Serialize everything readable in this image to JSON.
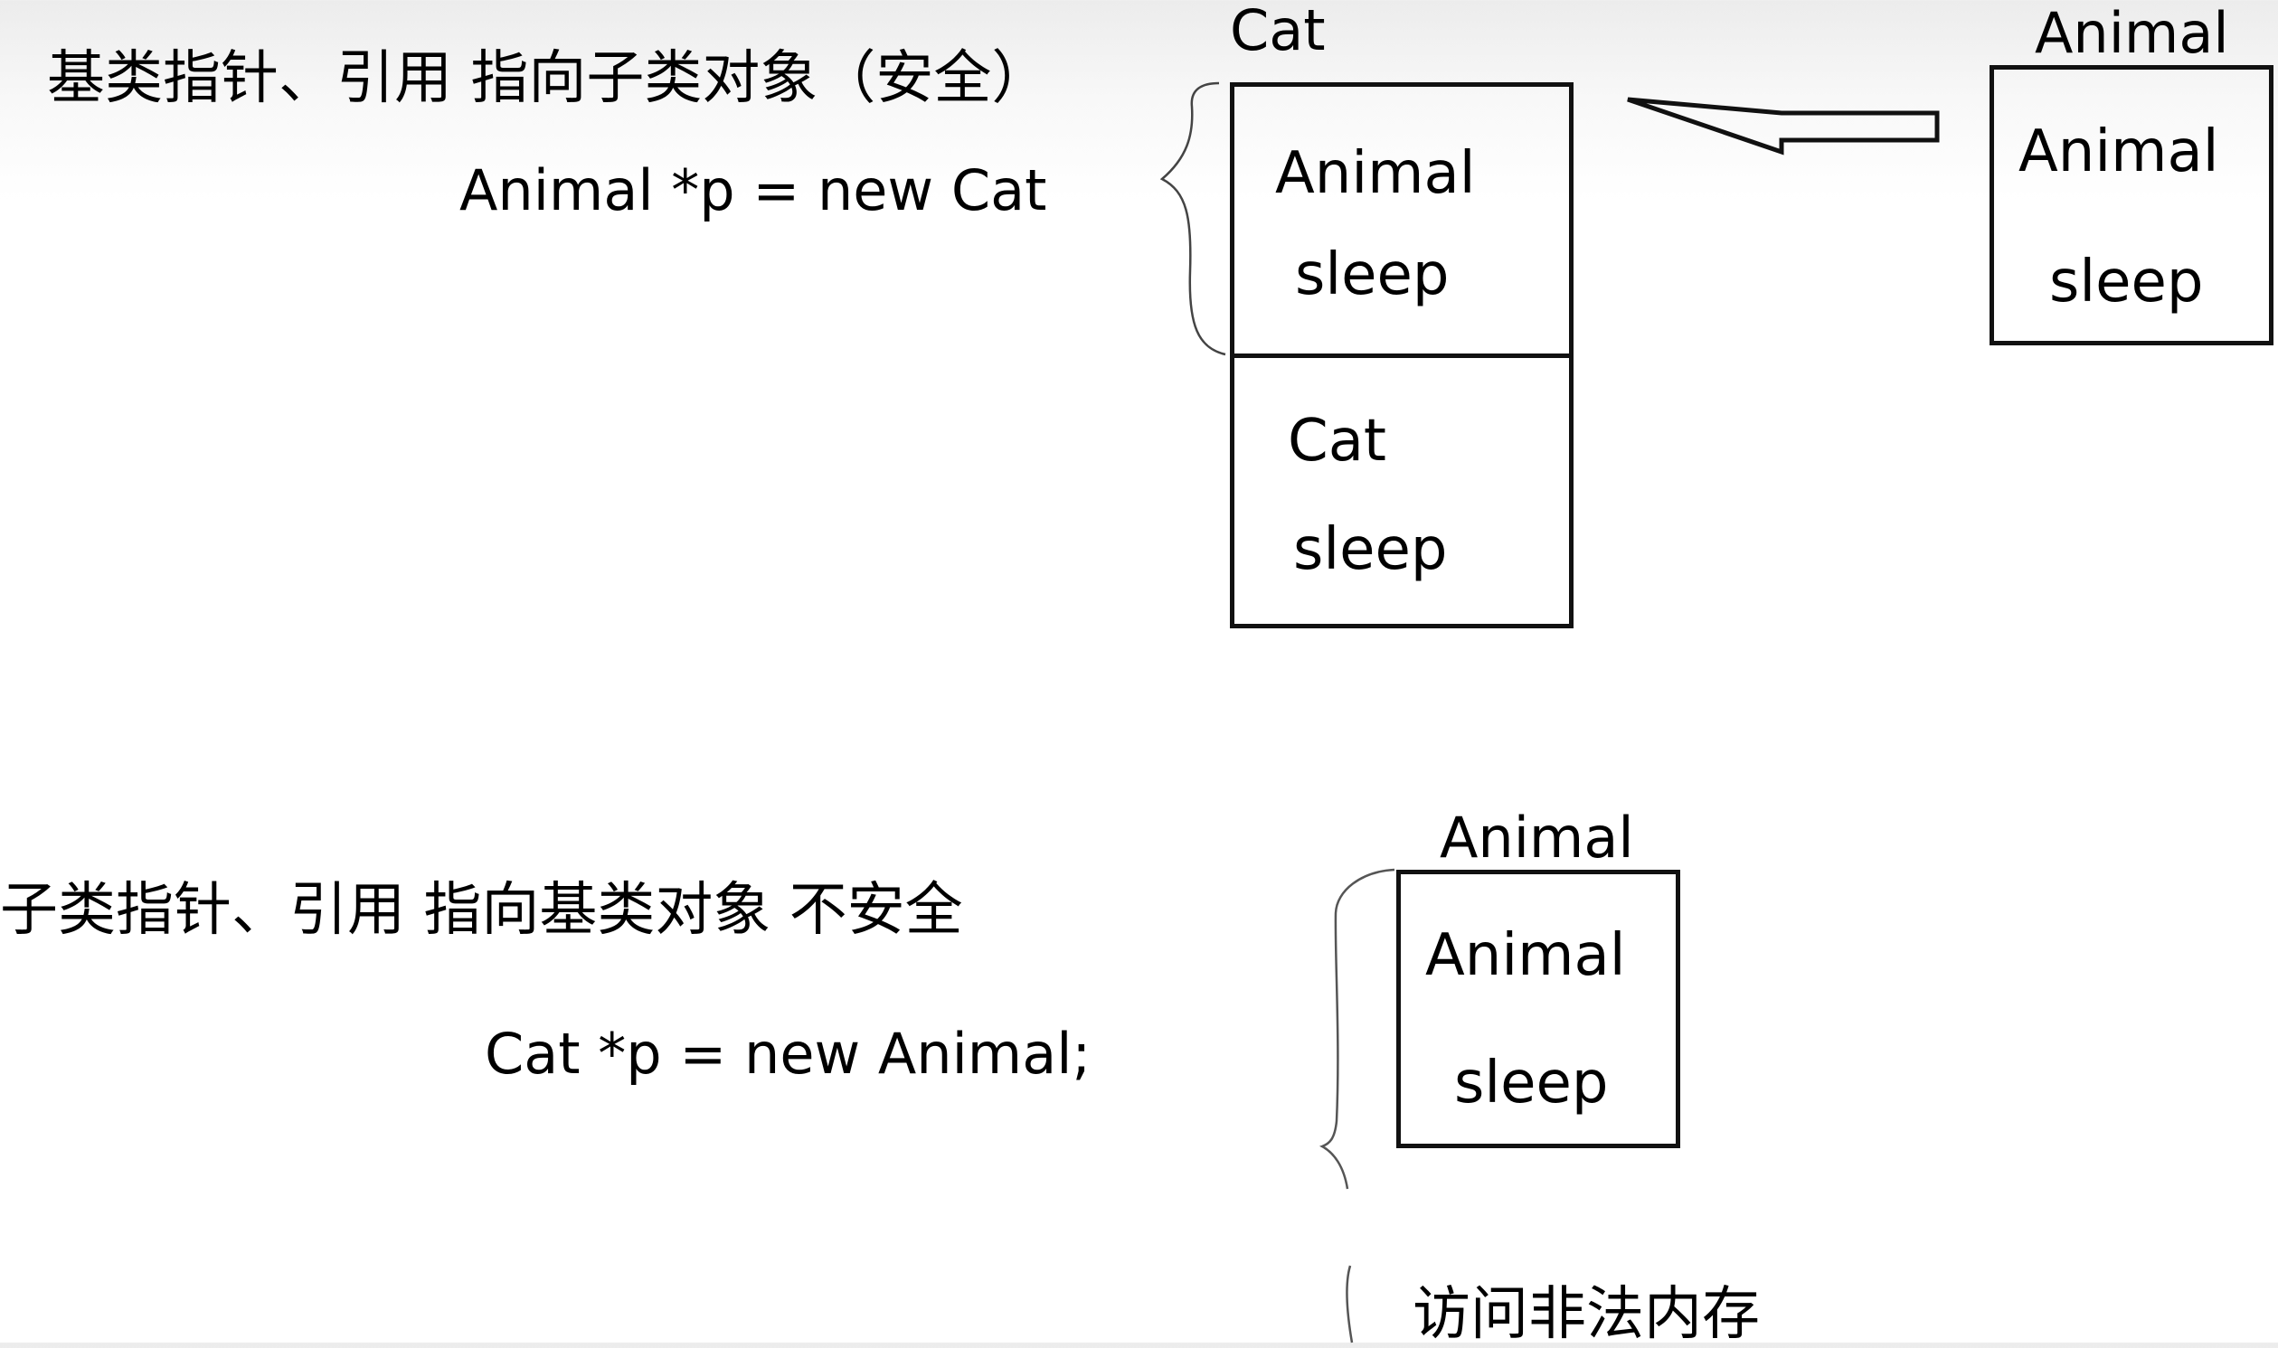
{
  "top": {
    "heading": "基类指针、引用 指向子类对象（安全）",
    "code": "Animal *p = new Cat",
    "cat_object": {
      "title": "Cat",
      "base_part": {
        "class": "Animal",
        "method": "sleep"
      },
      "derived_part": {
        "class": "Cat",
        "method": "sleep"
      }
    },
    "animal_object": {
      "title": "Animal",
      "part": {
        "class": "Animal",
        "method": "sleep"
      }
    }
  },
  "bottom": {
    "heading": "子类指针、引用  指向基类对象  不安全",
    "code": "Cat *p = new Animal;",
    "animal_object": {
      "title": "Animal",
      "part": {
        "class": "Animal",
        "method": "sleep"
      }
    },
    "note": "访问非法内存"
  }
}
